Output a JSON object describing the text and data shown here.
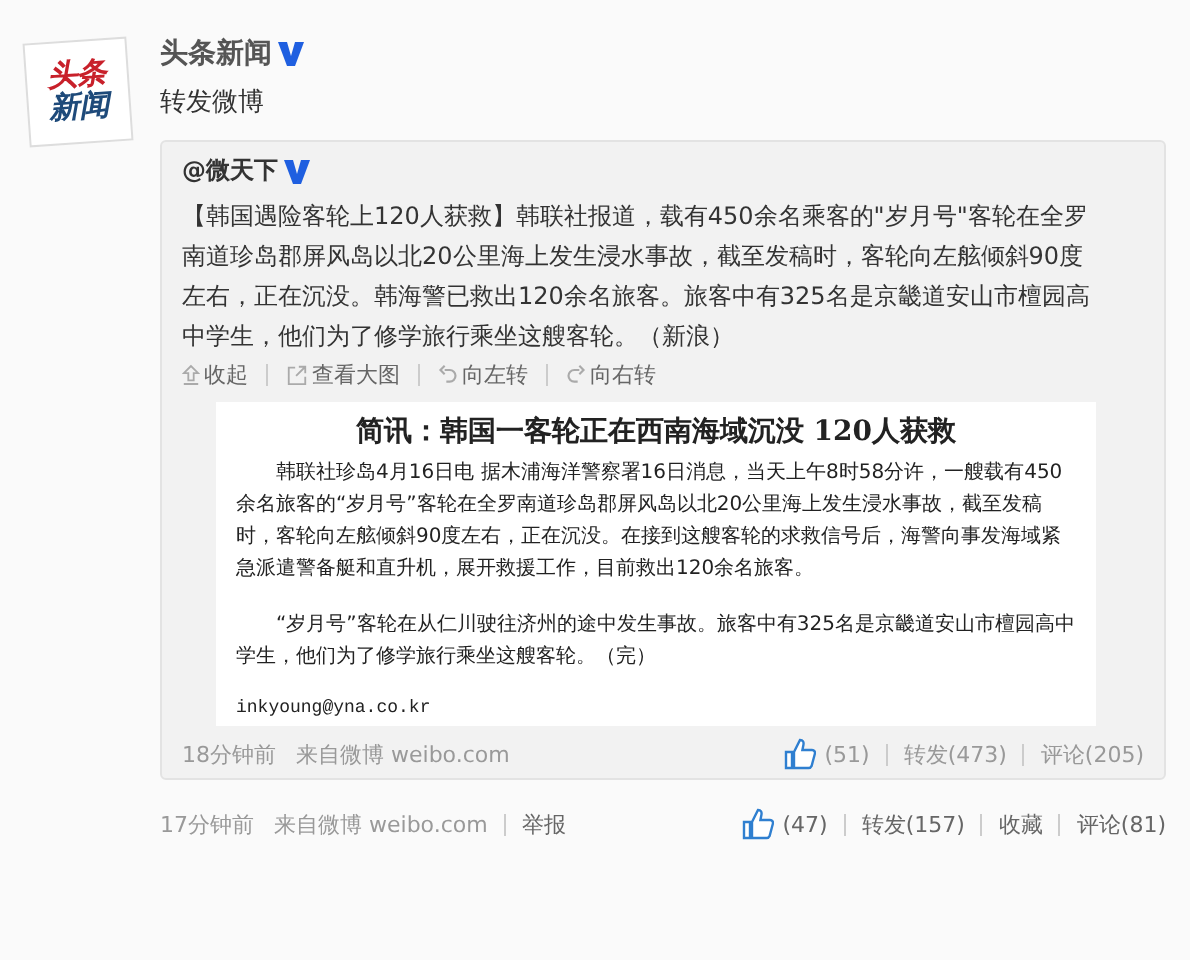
{
  "account": {
    "logo_lines": [
      "头条",
      "新闻"
    ],
    "name": "头条新闻",
    "verified": true
  },
  "post_text": "转发微博",
  "retweet": {
    "author": "@微天下",
    "verified": true,
    "text": "【韩国遇险客轮上120人获救】韩联社报道，载有450余名乘客的\"岁月号\"客轮在全罗南道珍岛郡屏风岛以北20公里海上发生浸水事故，截至发稿时，客轮向左舷倾斜90度左右，正在沉没。韩海警已救出120余名旅客。旅客中有325名是京畿道安山市檀园高中学生，他们为了修学旅行乘坐这艘客轮。（新浪）",
    "image_actions": [
      {
        "kind": "collapse",
        "label": "收起"
      },
      {
        "kind": "enlarge",
        "label": "查看大图"
      },
      {
        "kind": "rotate-left",
        "label": "向左转"
      },
      {
        "kind": "rotate-right",
        "label": "向右转"
      }
    ],
    "document": {
      "title": "简讯：韩国一客轮正在西南海域沉没  120人获救",
      "paragraphs": [
        "韩联社珍岛4月16日电 据木浦海洋警察署16日消息，当天上午8时58分许，一艘载有450余名旅客的“岁月号”客轮在全罗南道珍岛郡屏风岛以北20公里海上发生浸水事故，截至发稿时，客轮向左舷倾斜90度左右，正在沉没。在接到这艘客轮的求救信号后，海警向事发海域紧急派遣警备艇和直升机，展开救援工作，目前救出120余名旅客。",
        "“岁月号”客轮在从仁川驶往济州的途中发生事故。旅客中有325名是京畿道安山市檀园高中学生，他们为了修学旅行乘坐这艘客轮。（完）"
      ],
      "email": "inkyoung@yna.co.kr"
    },
    "time": "18分钟前",
    "source": "来自微博 weibo.com",
    "likes": "(51)",
    "reposts": "转发(473)",
    "comments": "评论(205)"
  },
  "footer": {
    "time": "17分钟前",
    "source": "来自微博 weibo.com",
    "report": "举报",
    "likes": "(47)",
    "reposts": "转发(157)",
    "favorite": "收藏",
    "comments": "评论(81)"
  }
}
